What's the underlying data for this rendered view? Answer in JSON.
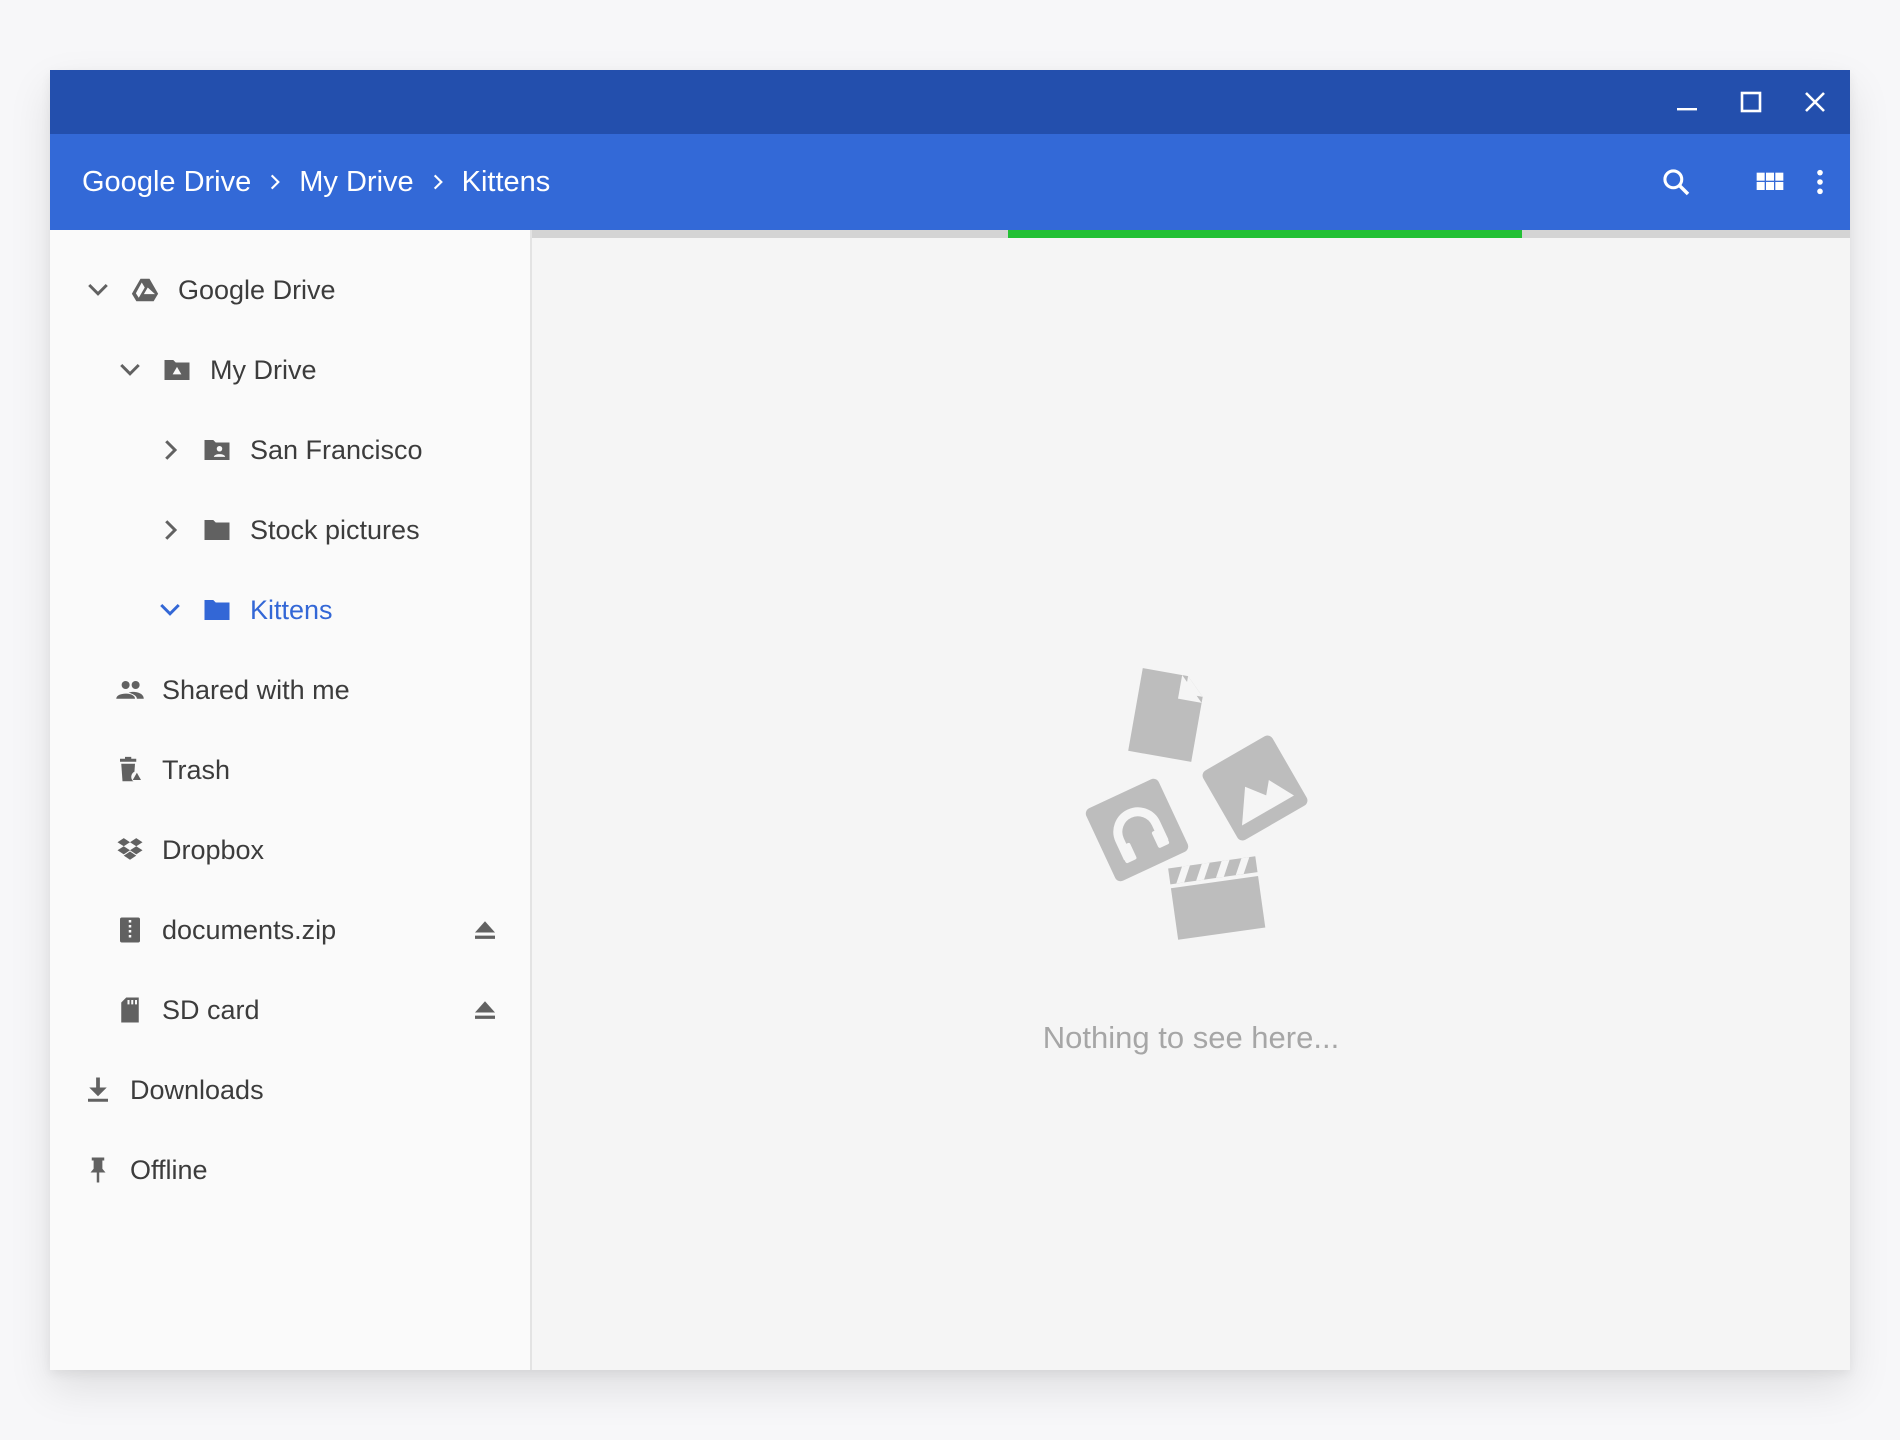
{
  "window": {
    "controls": [
      {
        "name": "minimize-button",
        "icon": "minimize-icon"
      },
      {
        "name": "maximize-button",
        "icon": "maximize-icon"
      },
      {
        "name": "close-button",
        "icon": "close-icon"
      }
    ]
  },
  "header": {
    "breadcrumb": [
      "Google Drive",
      "My Drive",
      "Kittens"
    ],
    "actions": [
      {
        "name": "search-button",
        "icon": "search-icon"
      },
      {
        "name": "grid-view-button",
        "icon": "grid-view-icon"
      },
      {
        "name": "more-options-button",
        "icon": "more-vert-icon"
      }
    ]
  },
  "sidebar": {
    "items": [
      {
        "label": "Google Drive",
        "icon": "google-drive-icon",
        "expand": "expanded"
      },
      {
        "label": "My Drive",
        "icon": "my-drive-folder-icon",
        "expand": "expanded"
      },
      {
        "label": "San Francisco",
        "icon": "shared-folder-icon",
        "expand": "collapsed"
      },
      {
        "label": "Stock pictures",
        "icon": "folder-icon",
        "expand": "collapsed"
      },
      {
        "label": "Kittens",
        "icon": "folder-icon",
        "expand": "expanded",
        "active": true
      },
      {
        "label": "Shared with me",
        "icon": "people-icon"
      },
      {
        "label": "Trash",
        "icon": "trash-icon"
      },
      {
        "label": "Dropbox",
        "icon": "dropbox-icon"
      },
      {
        "label": "documents.zip",
        "icon": "zip-archive-icon",
        "eject": true
      },
      {
        "label": "SD card",
        "icon": "sd-card-icon",
        "eject": true
      },
      {
        "label": "Downloads",
        "icon": "download-icon"
      },
      {
        "label": "Offline",
        "icon": "pin-icon"
      }
    ]
  },
  "main": {
    "progress": 0.39,
    "empty_message": "Nothing to see here..."
  },
  "colors": {
    "titlebar": "#234fad",
    "header": "#3369d7",
    "active_text": "#3367d6",
    "progress": "#22c035",
    "icon_gray": "#616161",
    "empty_art": "#bdbdbd"
  }
}
